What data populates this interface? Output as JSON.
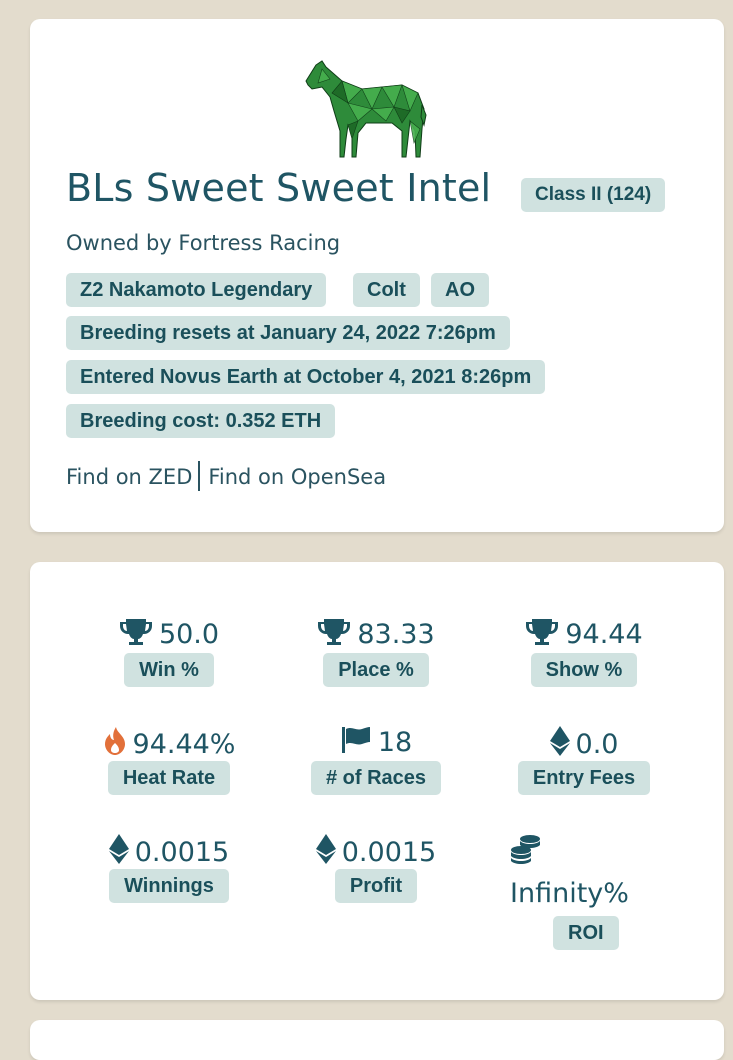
{
  "horse": {
    "name": "BLs Sweet Sweet Intel",
    "class_badge": "Class II (124)",
    "owner_text": "Owned by Fortress Racing",
    "tags": [
      "Z2 Nakamoto Legendary",
      "Colt",
      "AO"
    ],
    "breeding_reset": "Breeding resets at January 24, 2022 7:26pm",
    "entered": "Entered Novus Earth at October 4, 2021 8:26pm",
    "breeding_cost": "Breeding cost: 0.352 ETH",
    "coat_color": "#2e8b3a"
  },
  "links": {
    "zed": "Find on ZED",
    "opensea": "Find on OpenSea"
  },
  "stats": {
    "win": {
      "value": "50.0",
      "label": "Win %",
      "icon": "trophy-icon"
    },
    "place": {
      "value": "83.33",
      "label": "Place %",
      "icon": "trophy-icon"
    },
    "show": {
      "value": "94.44",
      "label": "Show %",
      "icon": "trophy-icon"
    },
    "heat": {
      "value": "94.44%",
      "label": "Heat Rate",
      "icon": "fire-icon"
    },
    "races": {
      "value": "18",
      "label": "# of Races",
      "icon": "flag-icon"
    },
    "entry_fees": {
      "value": "0.0",
      "label": "Entry Fees",
      "icon": "ethereum-icon"
    },
    "winnings": {
      "value": "0.0015",
      "label": "Winnings",
      "icon": "ethereum-icon"
    },
    "profit": {
      "value": "0.0015",
      "label": "Profit",
      "icon": "ethereum-icon"
    },
    "roi": {
      "value": "Infinity%",
      "label": "ROI",
      "icon": "coins-icon"
    }
  },
  "colors": {
    "background": "#e3dccd",
    "accent_text": "#1f5564",
    "pill_bg": "#d0e2e0",
    "fire": "#e2703a"
  }
}
